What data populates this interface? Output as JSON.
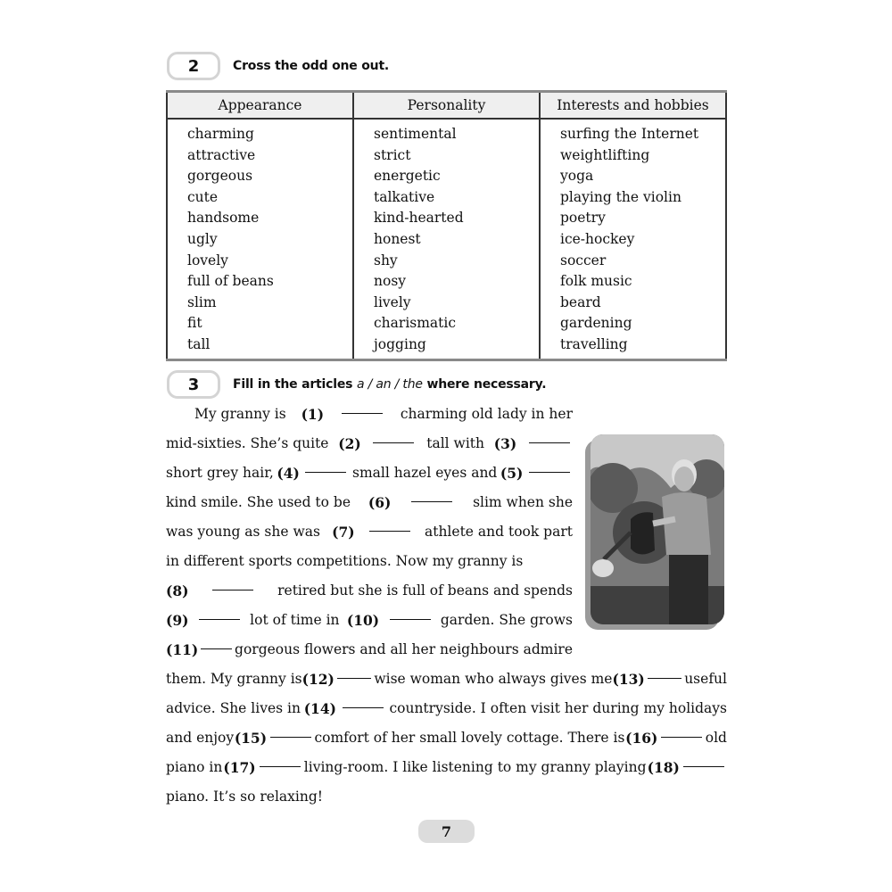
{
  "exercise2": {
    "number": "2",
    "instruction": "Cross the odd one out.",
    "table": {
      "headers": [
        "Appearance",
        "Personality",
        "Interests and hobbies"
      ],
      "columns": [
        [
          "charming",
          "attractive",
          "gorgeous",
          "cute",
          "handsome",
          "ugly",
          "lovely",
          "full of beans",
          "slim",
          "fit",
          "tall"
        ],
        [
          "sentimental",
          "strict",
          "energetic",
          "talkative",
          "kind-hearted",
          "honest",
          "shy",
          "nosy",
          "lively",
          "charismatic",
          "jogging"
        ],
        [
          "surfing the Internet",
          "weightlifting",
          "yoga",
          "playing the violin",
          "poetry",
          "ice-hockey",
          "soccer",
          "folk music",
          "beard",
          "gardening",
          "travelling"
        ]
      ]
    }
  },
  "exercise3": {
    "number": "3",
    "instruction_before": "Fill in the articles ",
    "instruction_options": "a / an / the",
    "instruction_after": " where necessary.",
    "photo_description": "Photo of an older woman with short grey hair watering a garden with a watering can",
    "lines": [
      {
        "parts": [
          "My granny is ",
          "(1)",
          "_",
          " charming old lady in her"
        ]
      },
      {
        "parts": [
          "mid-sixties. She’s quite ",
          "(2)",
          "_",
          " tall with ",
          "(3)",
          "_"
        ]
      },
      {
        "parts": [
          "short grey hair, ",
          "(4)",
          "_",
          " small hazel eyes and ",
          "(5)",
          "_"
        ]
      },
      {
        "parts": [
          "kind smile. She used to be ",
          "(6)",
          "_",
          " slim when she"
        ]
      },
      {
        "parts": [
          "was young as she was ",
          "(7)",
          "_",
          " athlete and took part"
        ]
      },
      {
        "parts": [
          "in different sports competitions. Now my granny is"
        ]
      },
      {
        "parts": [
          "(8)",
          "_",
          " retired but she is full of beans and spends"
        ]
      },
      {
        "parts": [
          "(9)",
          "_",
          " lot of time in ",
          "(10)",
          "_",
          " garden. She grows"
        ]
      },
      {
        "parts": [
          "(11)",
          "_",
          "gorgeous flowers and all her neighbours admire"
        ]
      },
      {
        "parts": [
          "them. My granny is ",
          "(12)",
          "_",
          " wise woman who always gives me ",
          "(13)",
          "_",
          " useful"
        ]
      },
      {
        "parts": [
          "advice. She lives in ",
          "(14)",
          "_",
          " countryside. I often visit her during my holidays"
        ]
      },
      {
        "parts": [
          "and enjoy ",
          "(15)",
          "_",
          " comfort of her small lovely cottage. There is ",
          "(16)",
          "_",
          " old"
        ]
      },
      {
        "parts": [
          "piano in ",
          "(17)",
          "_",
          " living-room. I like listening to my granny playing ",
          "(18)",
          "_"
        ]
      },
      {
        "parts": [
          "piano. It’s so relaxing!"
        ]
      }
    ]
  },
  "page_number": "7"
}
